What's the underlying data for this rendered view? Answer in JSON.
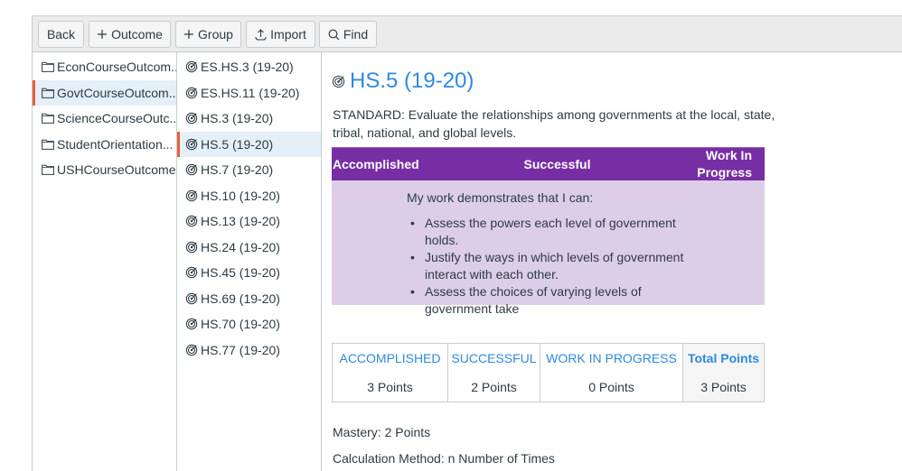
{
  "toolbar": {
    "back_label": "Back",
    "outcome_label": "Outcome",
    "group_label": "Group",
    "import_label": "Import",
    "find_label": "Find"
  },
  "groups": [
    {
      "label": "EconCourseOutcom...",
      "selected": false
    },
    {
      "label": "GovtCourseOutcom...",
      "selected": true
    },
    {
      "label": "ScienceCourseOutc...",
      "selected": false
    },
    {
      "label": "StudentOrientation...",
      "selected": false
    },
    {
      "label": "USHCourseOutcomes",
      "selected": false
    }
  ],
  "outcomes": [
    {
      "label": "ES.HS.3 (19-20)",
      "selected": false
    },
    {
      "label": "ES.HS.11 (19-20)",
      "selected": false
    },
    {
      "label": "HS.3 (19-20)",
      "selected": false
    },
    {
      "label": "HS.5 (19-20)",
      "selected": true
    },
    {
      "label": "HS.7 (19-20)",
      "selected": false
    },
    {
      "label": "HS.10 (19-20)",
      "selected": false
    },
    {
      "label": "HS.13 (19-20)",
      "selected": false
    },
    {
      "label": "HS.24 (19-20)",
      "selected": false
    },
    {
      "label": "HS.45 (19-20)",
      "selected": false
    },
    {
      "label": "HS.69 (19-20)",
      "selected": false
    },
    {
      "label": "HS.70 (19-20)",
      "selected": false
    },
    {
      "label": "HS.77 (19-20)",
      "selected": false
    }
  ],
  "detail": {
    "title": "HS.5 (19-20)",
    "standard": "STANDARD: Evaluate the relationships among governments at the local, state, tribal, national, and global levels.",
    "rubric": {
      "headers": [
        "Accomplished",
        "Successful",
        "Work In Progress"
      ],
      "intro": "My work demonstrates that I can:",
      "bullets": [
        "Assess the powers each level of government holds.",
        "Justify the ways in which levels of government interact with each other.",
        "Assess the choices of varying levels of government take"
      ]
    },
    "points": [
      {
        "label": "ACCOMPLISHED",
        "value": "3 Points"
      },
      {
        "label": "SUCCESSFUL",
        "value": "2 Points"
      },
      {
        "label": "WORK IN PROGRESS",
        "value": "0 Points"
      },
      {
        "label": "Total Points",
        "value": "3 Points"
      }
    ],
    "mastery": "Mastery: 2 Points",
    "calculation": "Calculation Method: n Number of Times"
  },
  "colors": {
    "accent": "#2d8ae0",
    "selected_marker": "#e66135",
    "rubric_header": "#772ea4",
    "rubric_body": "#dccee8"
  }
}
